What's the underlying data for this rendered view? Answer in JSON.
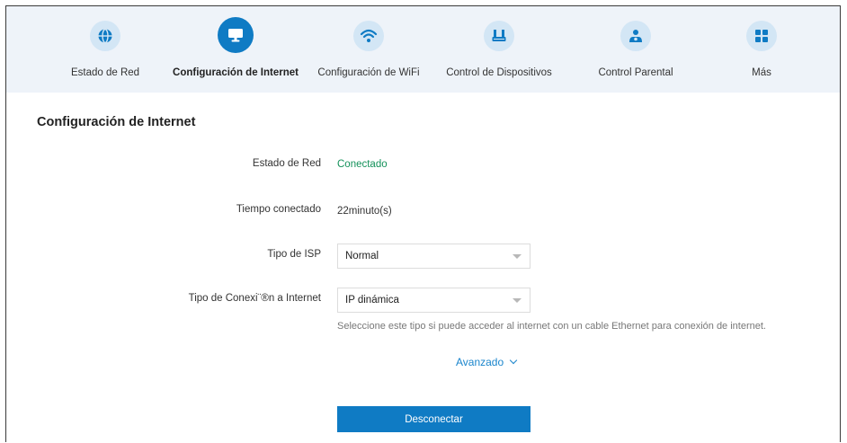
{
  "nav": {
    "items": [
      {
        "label": "Estado de Red",
        "icon": "globe-icon",
        "active": false
      },
      {
        "label": "Configuración de Internet",
        "icon": "monitor-icon",
        "active": true
      },
      {
        "label": "Configuración de WiFi",
        "icon": "wifi-icon",
        "active": false
      },
      {
        "label": "Control de Dispositivos",
        "icon": "router-icon",
        "active": false
      },
      {
        "label": "Control Parental",
        "icon": "parental-icon",
        "active": false
      },
      {
        "label": "Más",
        "icon": "grid-icon",
        "active": false
      }
    ],
    "accent": "#0f7bc4",
    "inactive_circle": "#d3e6f5"
  },
  "section": {
    "title": "Configuración de Internet"
  },
  "fields": {
    "network_status": {
      "label": "Estado de Red",
      "value": "Conectado",
      "color": "#14915a"
    },
    "connected_time": {
      "label": "Tiempo conectado",
      "value": "22minuto(s)"
    },
    "isp_type": {
      "label": "Tipo de ISP",
      "value": "Normal"
    },
    "connection_type": {
      "label": "Tipo de Conexi¨®n a Internet",
      "value": "IP dinámica"
    },
    "connection_hint": "Seleccione este tipo si puede acceder al internet con un cable Ethernet para conexión de internet."
  },
  "advanced": {
    "label": "Avanzado"
  },
  "actions": {
    "disconnect_label": "Desconectar"
  }
}
